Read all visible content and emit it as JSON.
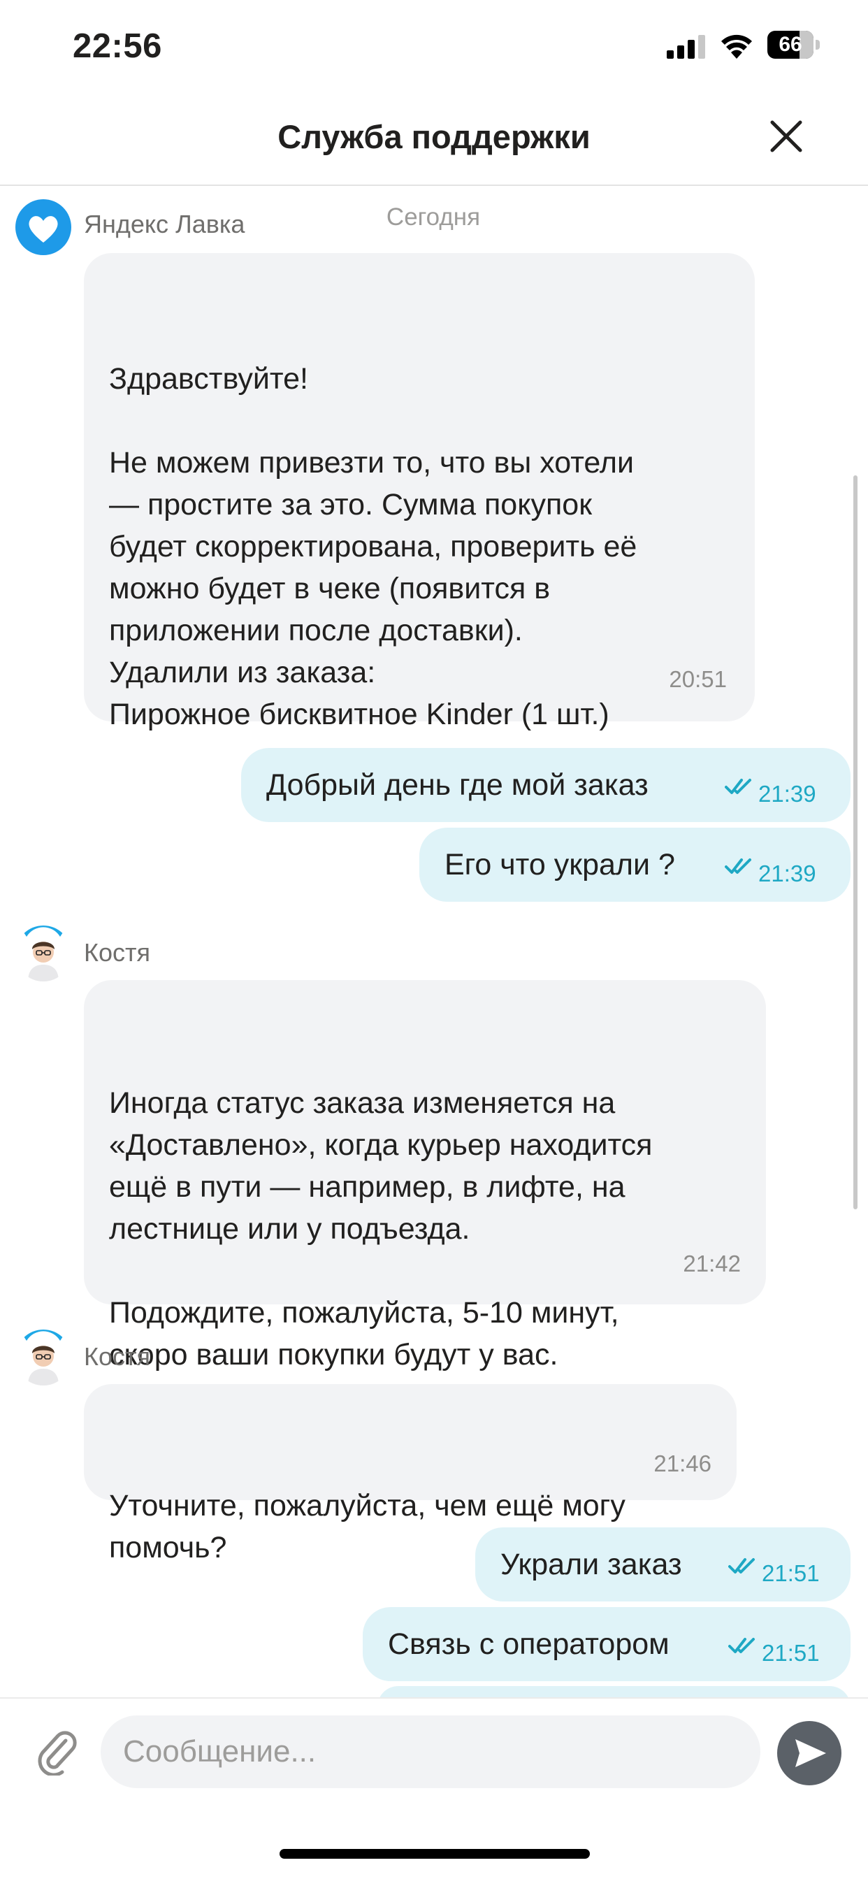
{
  "status_bar": {
    "time": "22:56",
    "battery": "66"
  },
  "header": {
    "title": "Служба поддержки"
  },
  "chat": {
    "date_label": "Сегодня",
    "messages": [
      {
        "sender": "Яндекс Лавка",
        "text": "Здравствуйте!\n\nНе можем привезти то, что вы хотели\n— простите за это. Сумма покупок\nбудет скорректирована, проверить её\nможно будет в чеке (появится в\nприложении после доставки).\nУдалили из заказа:\nПирожное бисквитное Kinder (1 шт.)",
        "time": "20:51"
      },
      {
        "text": "Добрый день где мой заказ",
        "time": "21:39"
      },
      {
        "text": "Его что украли ?",
        "time": "21:39"
      },
      {
        "sender": "Костя",
        "text": "Иногда статус заказа изменяется на\n«Доставлено», когда курьер находится\nещё в пути — например, в лифте, на\nлестнице или у подъезда.\n\nПодождите, пожалуйста, 5-10 минут,\nскоро ваши покупки будут у вас.",
        "time": "21:42"
      },
      {
        "sender": "Костя",
        "text": "Уточните, пожалуйста, чем ещё могу\nпомочь?",
        "time": "21:46"
      },
      {
        "text": "Украли заказ",
        "time": "21:51"
      },
      {
        "text": "Связь с оператором",
        "time": "21:51"
      }
    ]
  },
  "input": {
    "placeholder": "Сообщение..."
  },
  "colors": {
    "outgoing_bubble": "#dff3f8",
    "incoming_bubble": "#f2f3f5",
    "read_check": "#1ea8c4",
    "lavka_blue": "#1e9ae8"
  },
  "icons": [
    "signal-icon",
    "wifi-icon",
    "battery-icon",
    "close-icon",
    "yandex-lavka-logo-icon",
    "operator-avatar",
    "double-check-icon",
    "paperclip-icon",
    "send-icon"
  ]
}
